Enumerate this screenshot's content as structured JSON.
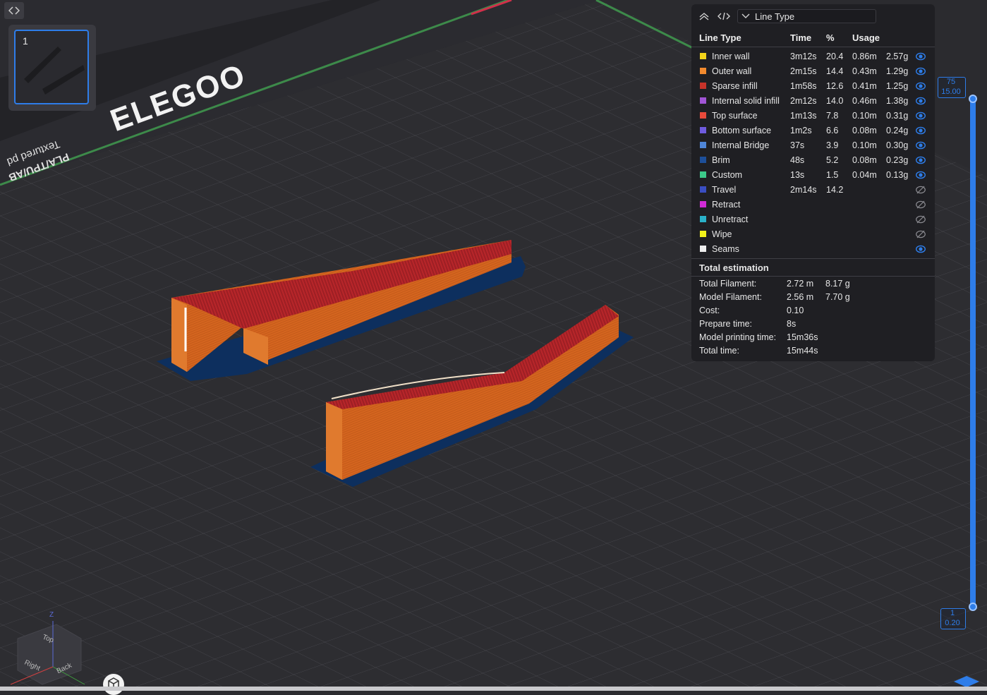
{
  "plate": {
    "number": "1"
  },
  "bed_labels": {
    "brand": "ELEGOO",
    "material_line1": "PLA/TPU/AB",
    "material_line2": "Textured pd"
  },
  "legend": {
    "dropdown_value": "Line Type",
    "columns": {
      "type": "Line Type",
      "time": "Time",
      "percent": "%",
      "usage": "Usage"
    },
    "rows": [
      {
        "name": "Inner wall",
        "color": "#f2d31a",
        "time": "3m12s",
        "percent": "20.4",
        "length": "0.86m",
        "weight": "2.57g",
        "visible": true
      },
      {
        "name": "Outer wall",
        "color": "#f28a2e",
        "time": "2m15s",
        "percent": "14.4",
        "length": "0.43m",
        "weight": "1.29g",
        "visible": true
      },
      {
        "name": "Sparse infill",
        "color": "#c7332a",
        "time": "1m58s",
        "percent": "12.6",
        "length": "0.41m",
        "weight": "1.25g",
        "visible": true
      },
      {
        "name": "Internal solid infill",
        "color": "#a155d6",
        "time": "2m12s",
        "percent": "14.0",
        "length": "0.46m",
        "weight": "1.38g",
        "visible": true
      },
      {
        "name": "Top surface",
        "color": "#e84a3b",
        "time": "1m13s",
        "percent": "7.8",
        "length": "0.10m",
        "weight": "0.31g",
        "visible": true
      },
      {
        "name": "Bottom surface",
        "color": "#6f5ce0",
        "time": "1m2s",
        "percent": "6.6",
        "length": "0.08m",
        "weight": "0.24g",
        "visible": true
      },
      {
        "name": "Internal Bridge",
        "color": "#4f86d9",
        "time": "37s",
        "percent": "3.9",
        "length": "0.10m",
        "weight": "0.30g",
        "visible": true
      },
      {
        "name": "Brim",
        "color": "#1d4f9a",
        "time": "48s",
        "percent": "5.2",
        "length": "0.08m",
        "weight": "0.23g",
        "visible": true
      },
      {
        "name": "Custom",
        "color": "#3cc98a",
        "time": "13s",
        "percent": "1.5",
        "length": "0.04m",
        "weight": "0.13g",
        "visible": true
      },
      {
        "name": "Travel",
        "color": "#3a4ec2",
        "time": "2m14s",
        "percent": "14.2",
        "length": "",
        "weight": "",
        "visible": false
      },
      {
        "name": "Retract",
        "color": "#d12bd6",
        "time": "",
        "percent": "",
        "length": "",
        "weight": "",
        "visible": false
      },
      {
        "name": "Unretract",
        "color": "#2ab1c9",
        "time": "",
        "percent": "",
        "length": "",
        "weight": "",
        "visible": false
      },
      {
        "name": "Wipe",
        "color": "#f2f21a",
        "time": "",
        "percent": "",
        "length": "",
        "weight": "",
        "visible": false
      },
      {
        "name": "Seams",
        "color": "#eeeeee",
        "time": "",
        "percent": "",
        "length": "",
        "weight": "",
        "visible": true
      }
    ],
    "total": {
      "title": "Total estimation",
      "rows": [
        {
          "label": "Total Filament:",
          "value": "2.72 m",
          "value2": "8.17 g"
        },
        {
          "label": "Model Filament:",
          "value": "2.56 m",
          "value2": "7.70 g"
        },
        {
          "label": "Cost:",
          "value": "0.10",
          "value2": ""
        },
        {
          "label": "Prepare time:",
          "value": "8s",
          "value2": ""
        },
        {
          "label": "Model printing time:",
          "value": "15m36s",
          "value2": ""
        },
        {
          "label": "Total time:",
          "value": "15m44s",
          "value2": ""
        }
      ]
    }
  },
  "layer_slider": {
    "top_layer": "75",
    "top_height": "15.00",
    "bottom_layer": "1",
    "bottom_height": "0.20"
  },
  "view_cube": {
    "top": "Top",
    "right": "Right",
    "back": "Back",
    "axis_z": "Z"
  },
  "icons": {
    "collapse": "chevron-left-right-icon",
    "panel_collapse": "double-chevron-up-icon",
    "code": "code-icon",
    "dropdown": "chevron-down-icon",
    "visible": "eye-icon",
    "hidden": "eye-off-icon",
    "cube": "cube-icon"
  },
  "colors": {
    "accent": "#2e7de9",
    "part_wall": "#d4651f",
    "part_top": "#b8262a",
    "brim": "#0d2f5e"
  }
}
